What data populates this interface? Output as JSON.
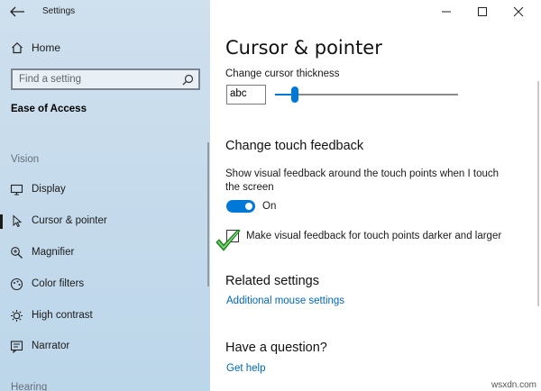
{
  "window": {
    "title": "Settings"
  },
  "sidebar": {
    "home_label": "Home",
    "search_placeholder": "Find a setting",
    "section_title": "Ease of Access",
    "group_vision": "Vision",
    "items": [
      {
        "label": "Display",
        "icon": "display-icon",
        "selected": false
      },
      {
        "label": "Cursor & pointer",
        "icon": "cursor-icon",
        "selected": true
      },
      {
        "label": "Magnifier",
        "icon": "magnifier-icon",
        "selected": false
      },
      {
        "label": "Color filters",
        "icon": "color-filters-icon",
        "selected": false
      },
      {
        "label": "High contrast",
        "icon": "high-contrast-icon",
        "selected": false
      },
      {
        "label": "Narrator",
        "icon": "narrator-icon",
        "selected": false
      }
    ],
    "group_hearing": "Hearing"
  },
  "main": {
    "page_title": "Cursor & pointer",
    "cursor_thickness_label": "Change cursor thickness",
    "cursor_thickness_preview": "abc",
    "cursor_thickness_level": 0.11,
    "touch_section_title": "Change touch feedback",
    "touch_feedback_label": "Show visual feedback around the touch points when I touch the screen",
    "toggle_state": "On",
    "darker_larger_label": "Make visual feedback for touch points darker and larger",
    "darker_larger_checked": false,
    "related_title": "Related settings",
    "related_link": "Additional mouse settings",
    "question_title": "Have a question?",
    "help_link": "Get help"
  },
  "colors": {
    "accent": "#0078d7",
    "link": "#0067b8",
    "sidebar_bg": "#c7dcec"
  },
  "watermark": "wsxdn.com"
}
